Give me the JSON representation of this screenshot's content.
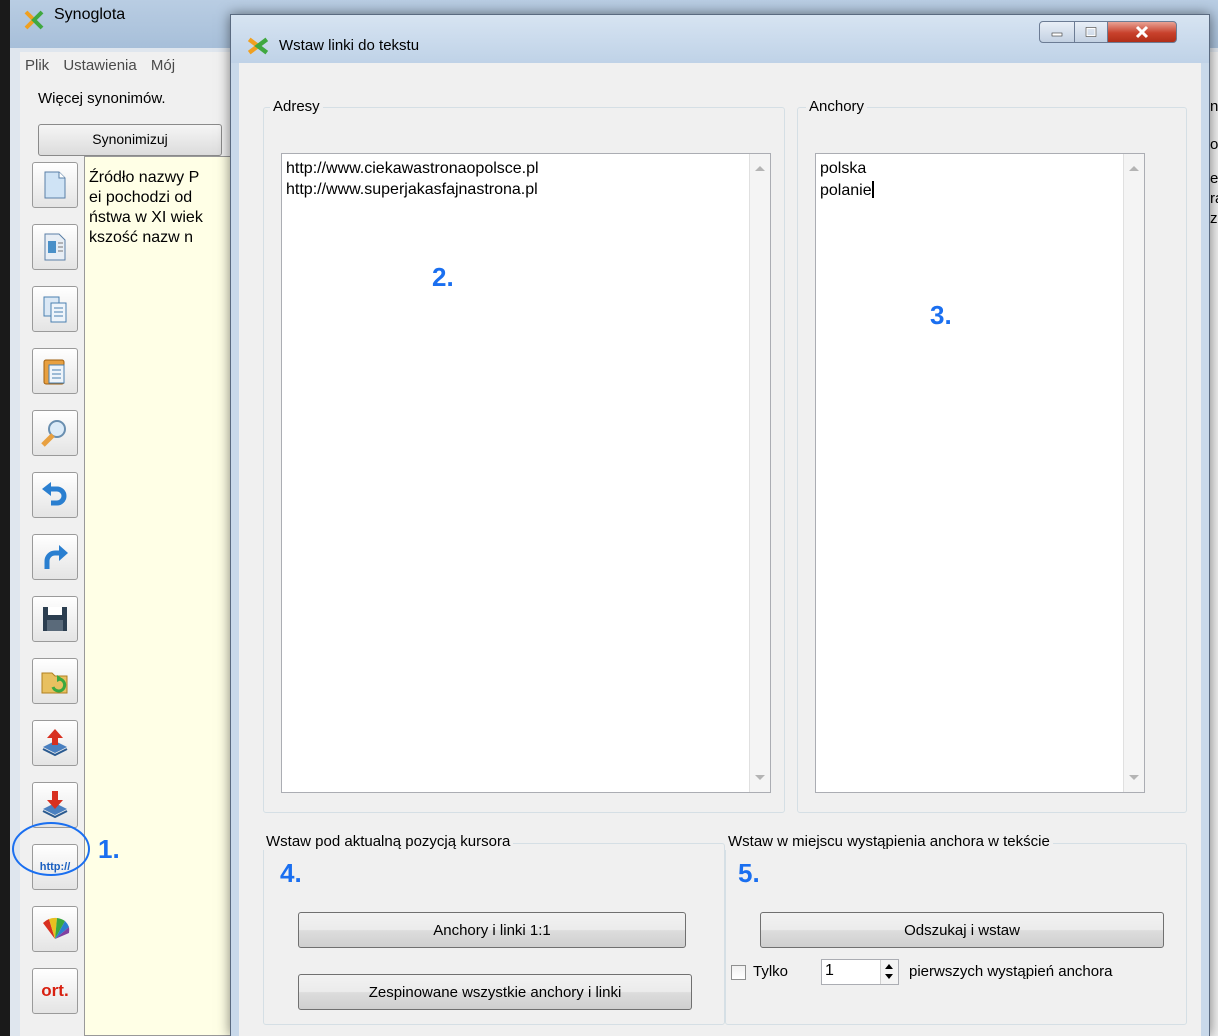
{
  "main_window": {
    "title": "Synoglota",
    "menu": [
      "Plik",
      "Ustawienia",
      "Mój"
    ],
    "status": "Więcej synonimów.",
    "synonimizuj_label": "Synonimizuj",
    "editor_lines": [
      "Źródło nazwy P",
      "ei pochodzi od",
      "ństwa w XI wiek",
      "kszość nazw n"
    ],
    "right_peek": [
      "n",
      "od",
      "er",
      "ra",
      "z"
    ],
    "toolbar_icons": [
      "new-document-icon",
      "document-text-icon",
      "copy-icon",
      "paste-icon",
      "search-edit-icon",
      "undo-icon",
      "redo-icon",
      "save-icon",
      "open-folder-icon",
      "upload-icon",
      "download-icon",
      "http-link-icon",
      "color-palette-icon",
      "spellcheck-icon"
    ],
    "http_label": "http://",
    "ort_label": "ort."
  },
  "dialog": {
    "title": "Wstaw linki do tekstu",
    "adresy": {
      "label": "Adresy",
      "lines": [
        "http://www.ciekawastronaopolsce.pl",
        "http://www.superjakasfajnastrona.pl"
      ]
    },
    "anchory": {
      "label": "Anchory",
      "lines": [
        "polska",
        "polanie"
      ]
    },
    "group_cursor": {
      "label": "Wstaw pod aktualną pozycją kursora",
      "btn_1to1": "Anchory i linki 1:1",
      "btn_all": "Zespinowane wszystkie anchory i linki"
    },
    "group_anchor": {
      "label": "Wstaw w miejscu wystąpienia anchora w tekście",
      "btn_find": "Odszukaj i wstaw",
      "checkbox_label": "Tylko",
      "checkbox_checked": false,
      "count_value": "1",
      "suffix": "pierwszych wystąpień anchora"
    }
  },
  "annotations": [
    "1.",
    "2.",
    "3.",
    "4.",
    "5."
  ],
  "colors": {
    "annotation": "#1a6ff0",
    "editor_bg": "#ffffe6",
    "close_button": "#c8412c"
  }
}
